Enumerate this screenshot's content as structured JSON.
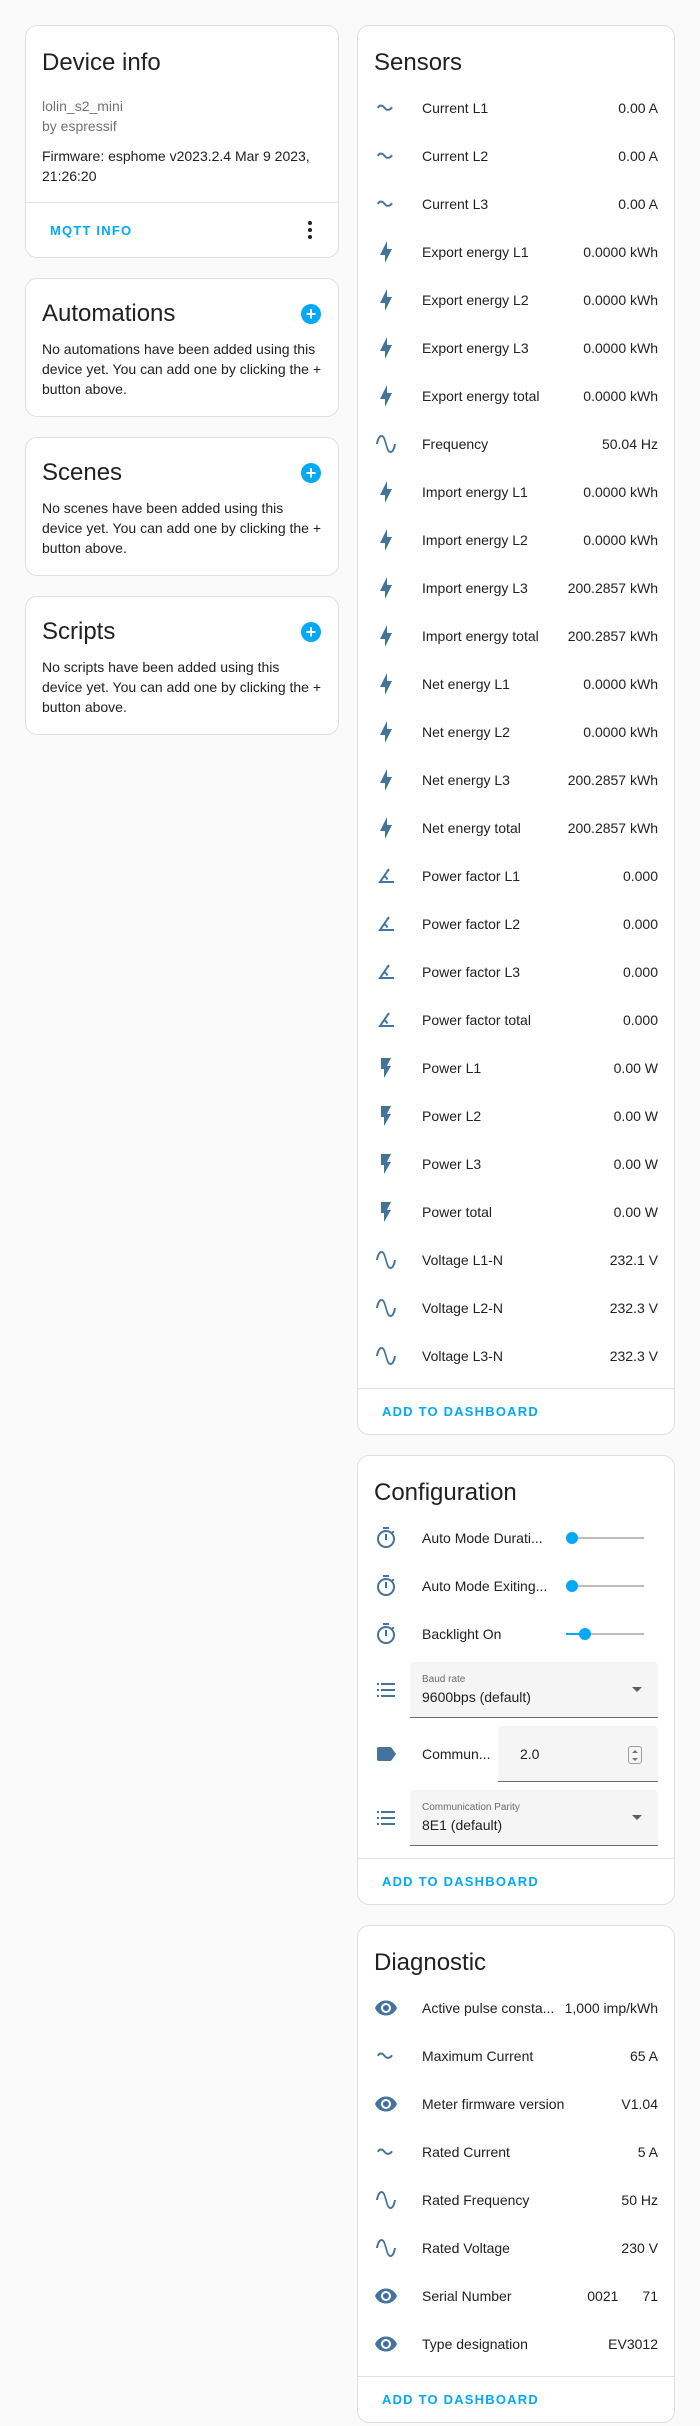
{
  "device_info": {
    "title": "Device info",
    "model": "lolin_s2_mini",
    "manufacturer": "by espressif",
    "firmware": "Firmware: esphome v2023.2.4 Mar 9 2023, 21:26:20",
    "mqtt_button": "MQTT INFO"
  },
  "automations": {
    "title": "Automations",
    "text": "No automations have been added using this device yet. You can add one by clicking the + button above."
  },
  "scenes": {
    "title": "Scenes",
    "text": "No scenes have been added using this device yet. You can add one by clicking the + button above."
  },
  "scripts": {
    "title": "Scripts",
    "text": "No scripts have been added using this device yet. You can add one by clicking the + button above."
  },
  "sensors": {
    "title": "Sensors",
    "add_button": "ADD TO DASHBOARD",
    "items": [
      {
        "icon": "current-ac-icon",
        "name": "Current L1",
        "value": "0.00 A"
      },
      {
        "icon": "current-ac-icon",
        "name": "Current L2",
        "value": "0.00 A"
      },
      {
        "icon": "current-ac-icon",
        "name": "Current L3",
        "value": "0.00 A"
      },
      {
        "icon": "lightning-bolt-icon",
        "name": "Export energy L1",
        "value": "0.0000 kWh"
      },
      {
        "icon": "lightning-bolt-icon",
        "name": "Export energy L2",
        "value": "0.0000 kWh"
      },
      {
        "icon": "lightning-bolt-icon",
        "name": "Export energy L3",
        "value": "0.0000 kWh"
      },
      {
        "icon": "lightning-bolt-icon",
        "name": "Export energy total",
        "value": "0.0000 kWh"
      },
      {
        "icon": "sine-wave-icon",
        "name": "Frequency",
        "value": "50.04 Hz"
      },
      {
        "icon": "lightning-bolt-icon",
        "name": "Import energy L1",
        "value": "0.0000 kWh"
      },
      {
        "icon": "lightning-bolt-icon",
        "name": "Import energy L2",
        "value": "0.0000 kWh"
      },
      {
        "icon": "lightning-bolt-icon",
        "name": "Import energy L3",
        "value": "200.2857 kWh"
      },
      {
        "icon": "lightning-bolt-icon",
        "name": "Import energy total",
        "value": "200.2857 kWh"
      },
      {
        "icon": "lightning-bolt-icon",
        "name": "Net energy L1",
        "value": "0.0000 kWh"
      },
      {
        "icon": "lightning-bolt-icon",
        "name": "Net energy L2",
        "value": "0.0000 kWh"
      },
      {
        "icon": "lightning-bolt-icon",
        "name": "Net energy L3",
        "value": "200.2857 kWh"
      },
      {
        "icon": "lightning-bolt-icon",
        "name": "Net energy total",
        "value": "200.2857 kWh"
      },
      {
        "icon": "angle-acute-icon",
        "name": "Power factor L1",
        "value": "0.000"
      },
      {
        "icon": "angle-acute-icon",
        "name": "Power factor L2",
        "value": "0.000"
      },
      {
        "icon": "angle-acute-icon",
        "name": "Power factor L3",
        "value": "0.000"
      },
      {
        "icon": "angle-acute-icon",
        "name": "Power factor total",
        "value": "0.000"
      },
      {
        "icon": "flash-icon",
        "name": "Power L1",
        "value": "0.00 W"
      },
      {
        "icon": "flash-icon",
        "name": "Power L2",
        "value": "0.00 W"
      },
      {
        "icon": "flash-icon",
        "name": "Power L3",
        "value": "0.00 W"
      },
      {
        "icon": "flash-icon",
        "name": "Power total",
        "value": "0.00 W"
      },
      {
        "icon": "sine-wave-icon",
        "name": "Voltage L1-N",
        "value": "232.1 V"
      },
      {
        "icon": "sine-wave-icon",
        "name": "Voltage L2-N",
        "value": "232.3 V"
      },
      {
        "icon": "sine-wave-icon",
        "name": "Voltage L3-N",
        "value": "232.3 V"
      }
    ]
  },
  "configuration": {
    "title": "Configuration",
    "add_button": "ADD TO DASHBOARD",
    "sliders": [
      {
        "name": "Auto Mode Durati...",
        "level": 0.0
      },
      {
        "name": "Auto Mode Exiting...",
        "level": 0.0
      },
      {
        "name": "Backlight On",
        "level": 0.2
      }
    ],
    "baud_rate": {
      "label": "Baud rate",
      "value": "9600bps (default)"
    },
    "communication": {
      "name": "Commun...",
      "value": "2.0"
    },
    "parity": {
      "label": "Communication Parity",
      "value": "8E1 (default)"
    }
  },
  "diagnostic": {
    "title": "Diagnostic",
    "add_button": "ADD TO DASHBOARD",
    "items": [
      {
        "icon": "eye-icon",
        "name": "Active pulse consta...",
        "value": "1,000 imp/kWh"
      },
      {
        "icon": "current-ac-icon",
        "name": "Maximum Current",
        "value": "65 A"
      },
      {
        "icon": "eye-icon",
        "name": "Meter firmware version",
        "value": "V1.04"
      },
      {
        "icon": "current-ac-icon",
        "name": "Rated Current",
        "value": "5 A"
      },
      {
        "icon": "sine-wave-icon",
        "name": "Rated Frequency",
        "value": "50 Hz"
      },
      {
        "icon": "sine-wave-icon",
        "name": "Rated Voltage",
        "value": "230 V"
      },
      {
        "icon": "eye-icon",
        "name": "Serial Number",
        "value": "0021",
        "value2": "71"
      },
      {
        "icon": "eye-icon",
        "name": "Type designation",
        "value": "EV3012"
      }
    ]
  },
  "colors": {
    "accent": "#03a9f4",
    "icon": "#44739e"
  }
}
